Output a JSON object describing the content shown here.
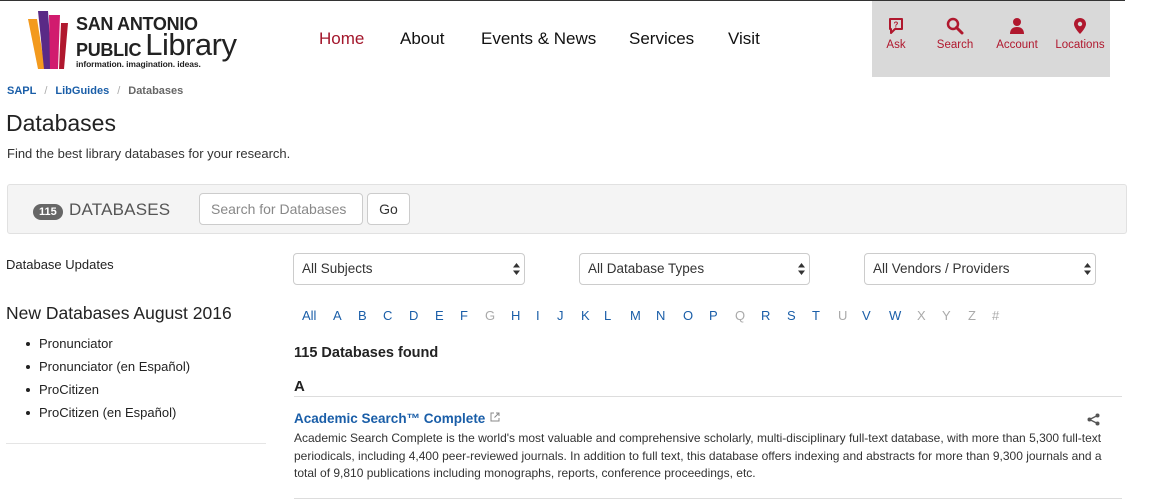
{
  "logo": {
    "line1": "SAN ANTONIO",
    "line2a": "PUBLIC",
    "line2b": "Library",
    "tagline": "information. imagination. ideas.",
    "colors": {
      "orange": "#f39a1e",
      "purple": "#5a2a86",
      "magenta": "#d11b6e",
      "red": "#b0182e"
    }
  },
  "main_nav": [
    "Home",
    "About",
    "Events & News",
    "Services",
    "Visit"
  ],
  "active_nav": "Home",
  "utility_nav": [
    {
      "label": "Ask",
      "icon": "chat-question-icon"
    },
    {
      "label": "Search",
      "icon": "search-icon"
    },
    {
      "label": "Account",
      "icon": "user-icon"
    },
    {
      "label": "Locations",
      "icon": "map-pin-icon"
    }
  ],
  "breadcrumb": {
    "items": [
      "SAPL",
      "LibGuides"
    ],
    "current": "Databases"
  },
  "page": {
    "title": "Databases",
    "subtitle": "Find the best library databases for your research."
  },
  "search": {
    "count": "115",
    "label": "DATABASES",
    "placeholder": "Search for Databases",
    "go_label": "Go"
  },
  "sidebar": {
    "updates_label": "Database Updates",
    "heading": "New Databases August 2016",
    "items": [
      "Pronunciator",
      "Pronunciator (en Español)",
      "ProCitizen",
      "ProCitizen (en Español)"
    ]
  },
  "filters": {
    "subjects": "All Subjects",
    "types": "All Database Types",
    "vendors": "All Vendors / Providers"
  },
  "alphabet": [
    {
      "l": "All",
      "on": true
    },
    {
      "l": "A",
      "on": true
    },
    {
      "l": "B",
      "on": true
    },
    {
      "l": "C",
      "on": true
    },
    {
      "l": "D",
      "on": true
    },
    {
      "l": "E",
      "on": true
    },
    {
      "l": "F",
      "on": true
    },
    {
      "l": "G",
      "on": false
    },
    {
      "l": "H",
      "on": true
    },
    {
      "l": "I",
      "on": true
    },
    {
      "l": "J",
      "on": true
    },
    {
      "l": "K",
      "on": true
    },
    {
      "l": "L",
      "on": true
    },
    {
      "l": "M",
      "on": true
    },
    {
      "l": "N",
      "on": true
    },
    {
      "l": "O",
      "on": true
    },
    {
      "l": "P",
      "on": true
    },
    {
      "l": "Q",
      "on": false
    },
    {
      "l": "R",
      "on": true
    },
    {
      "l": "S",
      "on": true
    },
    {
      "l": "T",
      "on": true
    },
    {
      "l": "U",
      "on": false
    },
    {
      "l": "V",
      "on": true
    },
    {
      "l": "W",
      "on": true
    },
    {
      "l": "X",
      "on": false
    },
    {
      "l": "Y",
      "on": false
    },
    {
      "l": "Z",
      "on": false
    },
    {
      "l": "#",
      "on": false
    }
  ],
  "results": {
    "found_text": "115 Databases found",
    "letter": "A",
    "entries": [
      {
        "title": "Academic Search™ Complete",
        "description": "Academic Search Complete is the world's most valuable and comprehensive scholarly, multi-disciplinary full-text database, with more than 5,300 full-text periodicals, including 4,400 peer-reviewed journals. In addition to full text, this database offers indexing and abstracts for more than 9,300 journals and a total of 9,810 publications including monographs, reports, conference proceedings, etc."
      }
    ]
  },
  "colors": {
    "link": "#1a5ea8",
    "accent": "#a3162b",
    "disabled": "#aaaaaa"
  }
}
